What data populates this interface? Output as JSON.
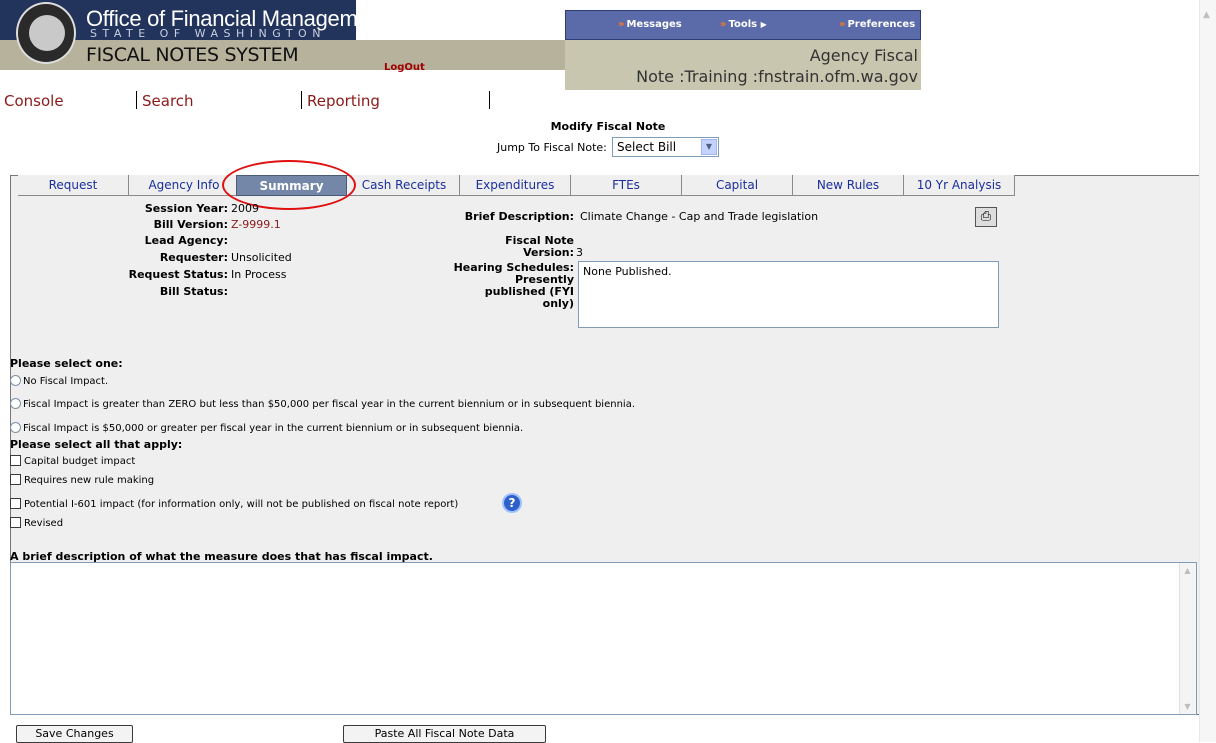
{
  "header": {
    "org_title": "Office of Financial Management",
    "org_subtitle": "STATE OF WASHINGTON",
    "system_title": "FISCAL NOTES SYSTEM",
    "logout": "LogOut",
    "menu": {
      "messages": "Messages",
      "tools": "Tools",
      "preferences": "Preferences"
    },
    "agency_line1": "Agency Fiscal",
    "agency_line2": "Note :Training :fnstrain.ofm.wa.gov",
    "arrow_glyph": "»",
    "play_glyph": "▶"
  },
  "nav": {
    "console": "Console",
    "search": "Search",
    "reporting": "Reporting"
  },
  "modify": {
    "title": "Modify Fiscal Note",
    "jump_label": "Jump To Fiscal Note:",
    "jump_value": "Select Bill"
  },
  "tabs": [
    {
      "label": "Request"
    },
    {
      "label": "Agency Info"
    },
    {
      "label": "Summary"
    },
    {
      "label": "Cash Receipts"
    },
    {
      "label": "Expenditures"
    },
    {
      "label": "FTEs"
    },
    {
      "label": "Capital"
    },
    {
      "label": "New Rules"
    },
    {
      "label": "10 Yr Analysis"
    }
  ],
  "active_tab": "Summary",
  "summary": {
    "session_year_label": "Session Year:",
    "session_year": "2009",
    "bill_version_label": "Bill Version:",
    "bill_version": "Z-9999.1",
    "lead_agency_label": "Lead Agency:",
    "lead_agency": "",
    "requester_label": "Requester:",
    "requester": "Unsolicited",
    "request_status_label": "Request Status:",
    "request_status": "In Process",
    "bill_status_label": "Bill Status:",
    "bill_status": "",
    "brief_desc_label": "Brief Description:",
    "brief_desc": "Climate Change - Cap and Trade legislation",
    "fn_version_label_1": "Fiscal Note",
    "fn_version_label_2": "Version:",
    "fn_version": "3",
    "hearing_label_1": "Hearing Schedules:",
    "hearing_label_2": "Presently",
    "hearing_label_3": "published (FYI",
    "hearing_label_4": "only)",
    "hearing_value": "None Published."
  },
  "impact": {
    "heading": "Please select one:",
    "options": [
      "No Fiscal Impact.",
      "Fiscal Impact is greater than ZERO but less than $50,000 per fiscal year in the current biennium or in subsequent biennia.",
      "Fiscal Impact is $50,000 or greater per fiscal year in the current biennium or in subsequent biennia."
    ],
    "checks_heading": "Please select all that apply:",
    "checks": [
      "Capital budget impact",
      "Requires new rule making",
      "Potential I-601 impact (for information only, will not be published on fiscal note report)",
      "Revised"
    ]
  },
  "description": {
    "heading": "A brief description of what the measure does that has fiscal impact.",
    "value": ""
  },
  "buttons": {
    "save": "Save Changes",
    "paste": "Paste All Fiscal Note Data"
  }
}
